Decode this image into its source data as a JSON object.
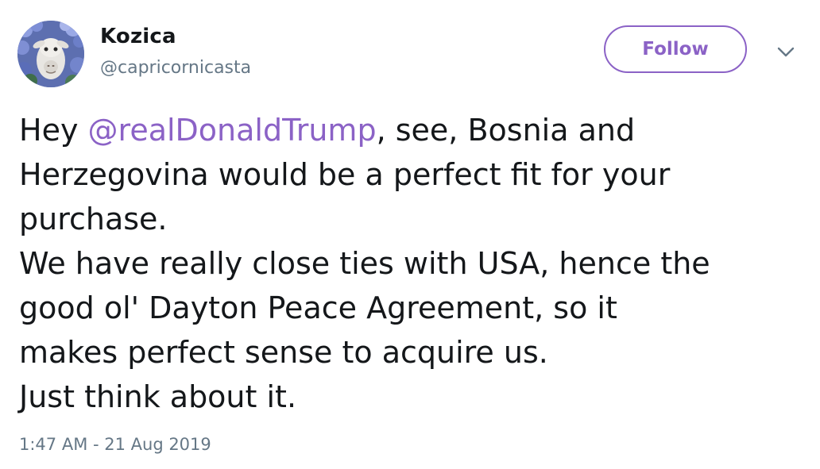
{
  "user": {
    "display_name": "Kozica",
    "handle": "@capricornicasta",
    "avatar_icon": "goat-with-flowers-avatar"
  },
  "follow_button": {
    "label": "Follow"
  },
  "menu": {
    "icon": "chevron-down-icon"
  },
  "tweet": {
    "line1_prefix": "Hey ",
    "mention": "@realDonaldTrump",
    "line1_suffix": ", see, Bosnia and",
    "line2": "Herzegovina would be a perfect fit for your",
    "line3": "purchase.",
    "line4": "We have really close ties with USA, hence the",
    "line5": "good ol' Dayton Peace Agreement, so it",
    "line6": "makes perfect sense to acquire us.",
    "line7": "Just think about it."
  },
  "timestamp": "1:47 AM - 21 Aug 2019",
  "colors": {
    "accent": "#8b62c6",
    "text": "#14171a",
    "secondary": "#657786"
  }
}
